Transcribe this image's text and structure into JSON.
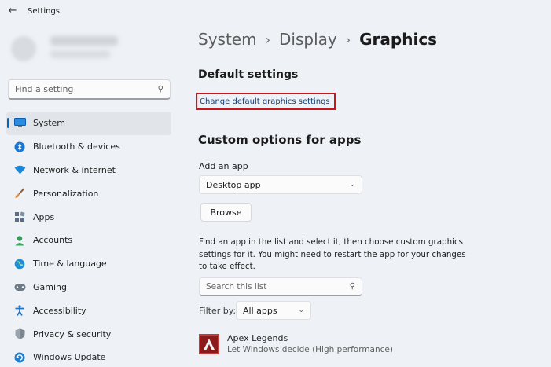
{
  "window": {
    "title": "Settings",
    "back_icon": "back-arrow-icon"
  },
  "sidebar": {
    "search": {
      "placeholder": "Find a setting",
      "icon": "search-icon"
    },
    "items": [
      {
        "label": "System",
        "icon": "monitor-icon",
        "color": "#0078d4",
        "active": true
      },
      {
        "label": "Bluetooth & devices",
        "icon": "bluetooth-icon",
        "color": "#0a6ed1"
      },
      {
        "label": "Network & internet",
        "icon": "wifi-icon",
        "color": "#1a86d9"
      },
      {
        "label": "Personalization",
        "icon": "brush-icon",
        "color": "#c4733b"
      },
      {
        "label": "Apps",
        "icon": "apps-icon",
        "color": "#5a6e85"
      },
      {
        "label": "Accounts",
        "icon": "person-icon",
        "color": "#2f9e59"
      },
      {
        "label": "Time & language",
        "icon": "globe-icon",
        "color": "#1d8fd8"
      },
      {
        "label": "Gaming",
        "icon": "gamepad-icon",
        "color": "#6c7a88"
      },
      {
        "label": "Accessibility",
        "icon": "accessibility-icon",
        "color": "#1a73c7"
      },
      {
        "label": "Privacy & security",
        "icon": "shield-icon",
        "color": "#6b7580"
      },
      {
        "label": "Windows Update",
        "icon": "update-icon",
        "color": "#1f7fd3"
      }
    ]
  },
  "breadcrumb": {
    "items": [
      "System",
      "Display"
    ],
    "current": "Graphics"
  },
  "default_settings": {
    "heading": "Default settings",
    "link": "Change default graphics settings"
  },
  "custom": {
    "heading": "Custom options for apps",
    "add_app_label": "Add an app",
    "app_type_value": "Desktop app",
    "browse_label": "Browse",
    "description": "Find an app in the list and select it, then choose custom graphics settings for it. You might need to restart the app for your changes to take effect.",
    "search_placeholder": "Search this list",
    "filter_label": "Filter by:",
    "filter_value": "All apps"
  },
  "apps": [
    {
      "name": "Apex Legends",
      "setting": "Let Windows decide (High performance)",
      "icon": "apex-legends-icon"
    }
  ],
  "colors": {
    "accent": "#0067c0",
    "highlight_box": "#c8161d",
    "link": "#0f3f79"
  }
}
